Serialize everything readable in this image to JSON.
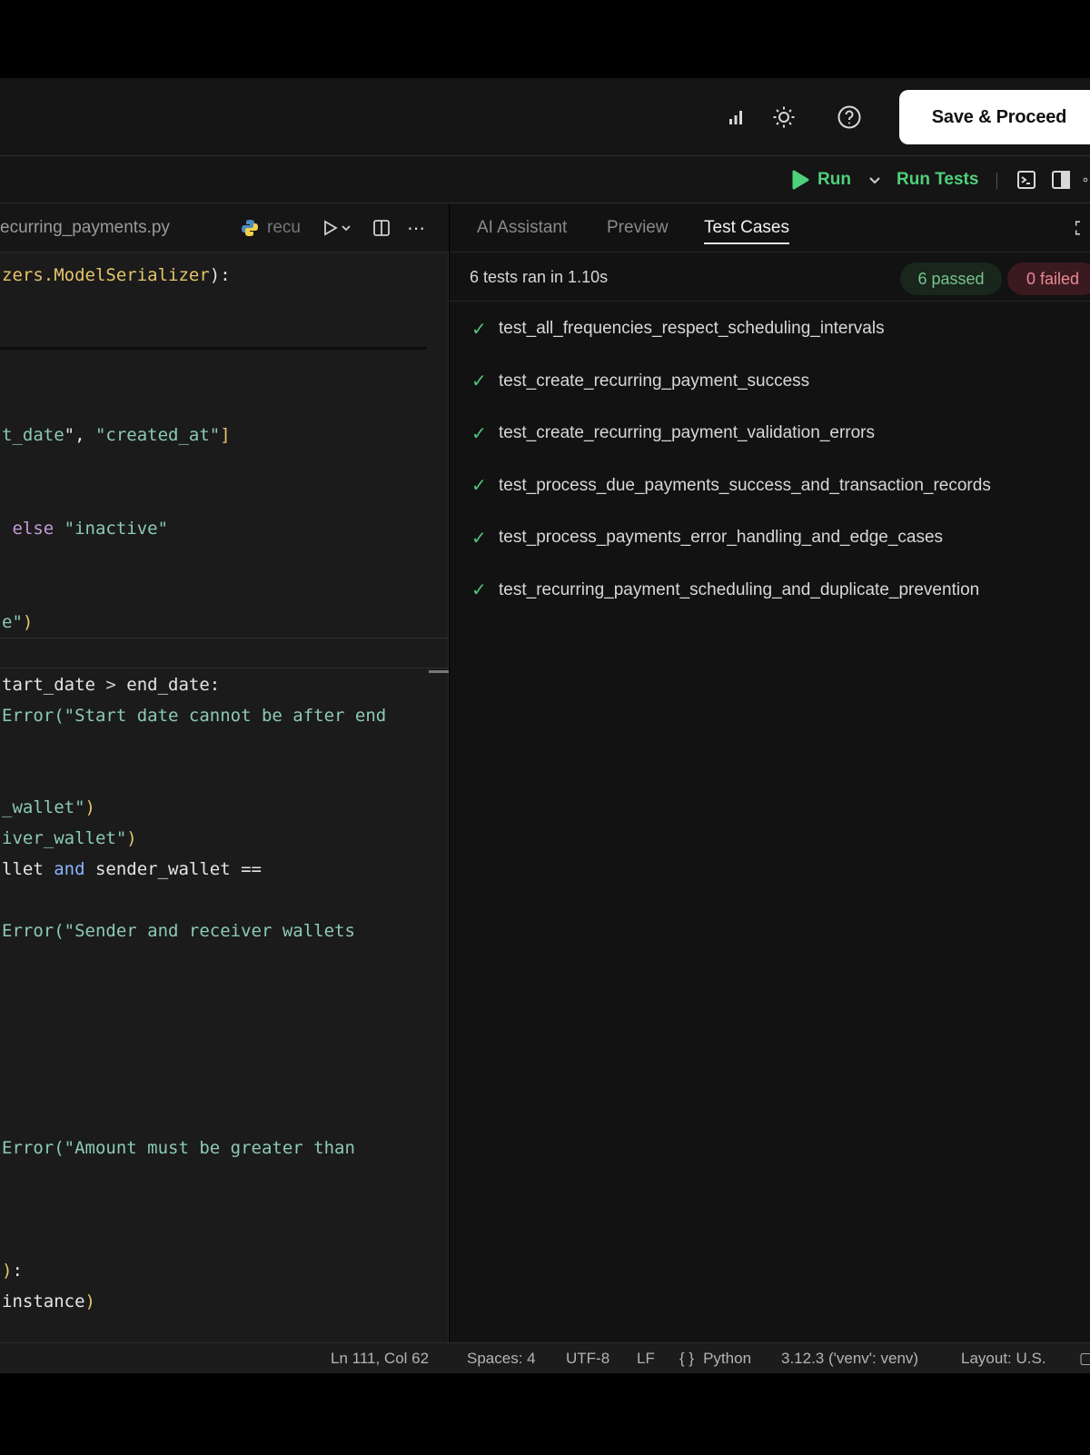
{
  "header": {
    "save_label": "Save & Proceed"
  },
  "toolbar": {
    "run_label": "Run",
    "run_tests_label": "Run Tests"
  },
  "editor": {
    "file_tab": "ecurring_payments.py",
    "file_tab2": "recu",
    "lines": [
      {
        "t": 14,
        "parts": [
          [
            "zers.ModelSerializer",
            "c-yellow"
          ],
          [
            "):",
            "c-white"
          ]
        ]
      },
      {
        "t": 190,
        "parts": [
          [
            "t_date",
            "c-str"
          ],
          [
            "\", ",
            "c-white"
          ],
          [
            "\"created_at\"",
            "c-str"
          ],
          [
            "]",
            "c-yellow"
          ]
        ]
      },
      {
        "t": 293,
        "parts": [
          [
            " else ",
            "c-kw"
          ],
          [
            "\"inactive\"",
            "c-str"
          ]
        ]
      },
      {
        "t": 396,
        "parts": [
          [
            "e\"",
            "c-str"
          ],
          [
            ")",
            "c-yellow"
          ]
        ]
      },
      {
        "t": 465,
        "parts": [
          [
            "tart_date ",
            "c-white"
          ],
          [
            ">",
            "c-op"
          ],
          [
            " end_date:",
            "c-white"
          ]
        ]
      },
      {
        "t": 499,
        "parts": [
          [
            "Error(",
            "c-str"
          ],
          [
            "\"Start date cannot be after end",
            "c-str"
          ]
        ]
      },
      {
        "t": 600,
        "parts": [
          [
            "_wallet\"",
            "c-str"
          ],
          [
            ")",
            "c-yellow"
          ]
        ]
      },
      {
        "t": 634,
        "parts": [
          [
            "iver_wallet\"",
            "c-str"
          ],
          [
            ")",
            "c-yellow"
          ]
        ]
      },
      {
        "t": 668,
        "parts": [
          [
            "llet ",
            "c-white"
          ],
          [
            "and",
            "c-blue"
          ],
          [
            " sender_wallet ==",
            "c-white"
          ]
        ]
      },
      {
        "t": 736,
        "parts": [
          [
            "Error(",
            "c-str"
          ],
          [
            "\"Sender and receiver wallets",
            "c-str"
          ]
        ]
      },
      {
        "t": 975,
        "parts": [
          [
            "Error(",
            "c-str"
          ],
          [
            "\"Amount must be greater than",
            "c-str"
          ]
        ]
      },
      {
        "t": 1110,
        "parts": [
          [
            ")",
            "c-yellow"
          ],
          [
            ":",
            "c-white"
          ]
        ]
      },
      {
        "t": 1144,
        "parts": [
          [
            "instance",
            "c-white"
          ],
          [
            ")",
            "c-yellow"
          ]
        ]
      }
    ]
  },
  "panel": {
    "tabs": [
      "AI Assistant",
      "Preview",
      "Test Cases"
    ],
    "active_tab": "Test Cases",
    "summary": "6 tests ran in 1.10s",
    "passed": "6 passed",
    "failed": "0 failed",
    "tests": [
      "test_all_frequencies_respect_scheduling_intervals",
      "test_create_recurring_payment_success",
      "test_create_recurring_payment_validation_errors",
      "test_process_due_payments_success_and_transaction_records",
      "test_process_payments_error_handling_and_edge_cases",
      "test_recurring_payment_scheduling_and_duplicate_prevention"
    ]
  },
  "status": {
    "position": "Ln 111, Col 62",
    "spaces": "Spaces: 4",
    "encoding": "UTF-8",
    "eol": "LF",
    "language": "Python",
    "interpreter": "3.12.3 ('venv': venv)",
    "layout": "Layout: U.S."
  },
  "colors": {
    "accent_green": "#4fd07a",
    "pass_badge": "#18261c",
    "fail_badge": "#3b1a1f"
  }
}
